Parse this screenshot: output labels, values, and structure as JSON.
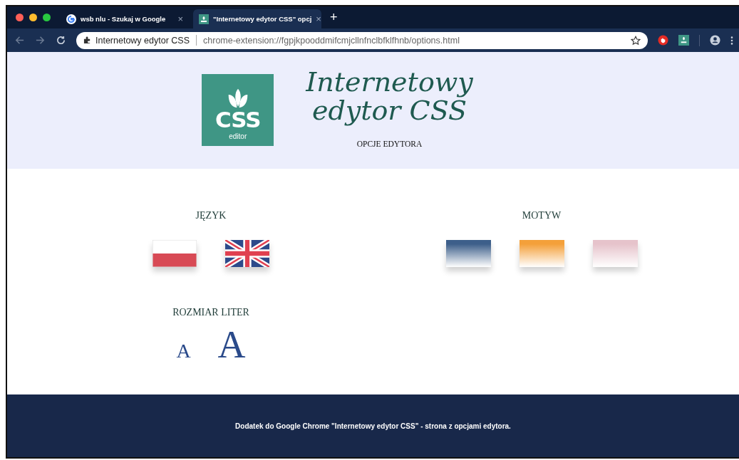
{
  "browser": {
    "tabs": [
      {
        "title": "wsb nlu - Szukaj w Google",
        "close": "×",
        "selected": false
      },
      {
        "title": "\"Internetowy edytor CSS\" opcj",
        "close": "×",
        "selected": true
      }
    ],
    "new_tab": "+",
    "address": {
      "site": "Internetowy edytor CSS",
      "url": "chrome-extension://fgpjkpooddmifcmjcllnfnclbfklfhnb/options.html"
    }
  },
  "header": {
    "logo": {
      "text": "CSS",
      "subtext": "editor"
    },
    "title_lines": [
      "Internetowy",
      "edytor CSS"
    ],
    "subtitle": "OPCJE EDYTORA"
  },
  "language": {
    "heading": "JĘZYK",
    "options": [
      {
        "kind": "pl"
      },
      {
        "kind": "gb"
      }
    ]
  },
  "theme": {
    "heading": "MOTYW",
    "options": [
      {
        "color": "#3d5f8a"
      },
      {
        "color": "#f4a03a"
      },
      {
        "color": "#e6c3cb"
      }
    ]
  },
  "font_size": {
    "heading": "ROZMIAR LITER",
    "options": [
      {
        "label": "A",
        "kind": "small"
      },
      {
        "label": "A",
        "kind": "large"
      }
    ]
  },
  "footer": {
    "text": "Dodatek do Google Chrome \"Internetowy edytor CSS\" - strona z opcjami edytora."
  }
}
